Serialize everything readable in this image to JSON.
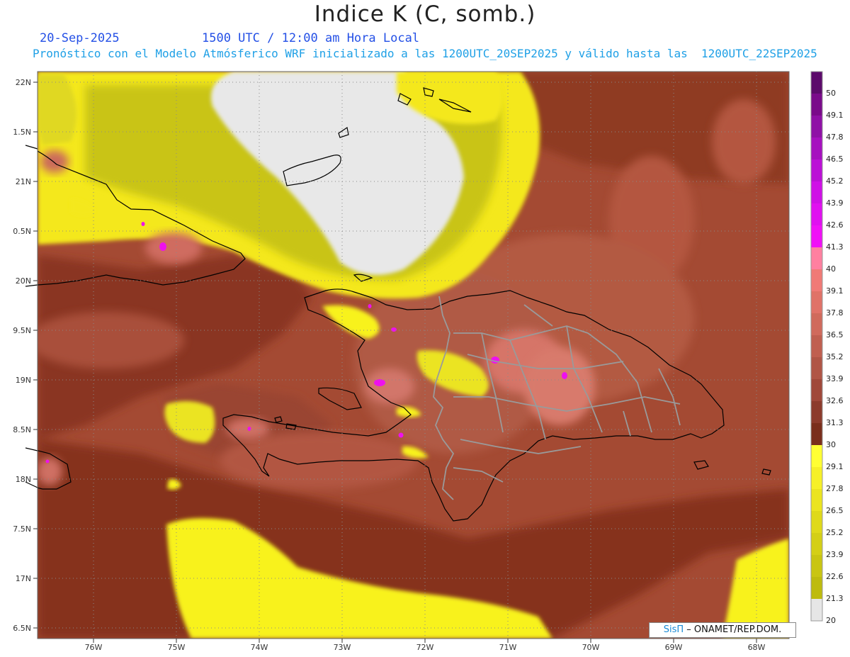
{
  "header": {
    "title": "Indice K (C, somb.)",
    "date": "20-Sep-2025",
    "time": "1500 UTC / 12:00 am Hora Local",
    "forecast": "Pronóstico con el Modelo Atmósferico WRF inicializado a las 1200UTC_20SEP2025 y válido hasta las  1200UTC_22SEP2025"
  },
  "map": {
    "lat_labels": [
      "22N",
      "1.5N",
      "21N",
      "0.5N",
      "20N",
      "9.5N",
      "19N",
      "8.5N",
      "18N",
      "7.5N",
      "17N",
      "6.5N"
    ],
    "lon_labels": [
      "76W",
      "75W",
      "74W",
      "73W",
      "72W",
      "71W",
      "70W",
      "69W",
      "68W"
    ],
    "background_color": "#a44a33",
    "grid": "dotted"
  },
  "colorbar": {
    "levels": [
      "50",
      "49.1",
      "47.8",
      "46.5",
      "45.2",
      "43.9",
      "42.6",
      "41.3",
      "40",
      "39.1",
      "37.8",
      "36.5",
      "35.2",
      "33.9",
      "32.6",
      "31.3",
      "30",
      "29.1",
      "27.8",
      "26.5",
      "25.2",
      "23.9",
      "22.6",
      "21.3",
      "20"
    ],
    "colors": [
      "#5c0a6b",
      "#7a0a8a",
      "#8f10a6",
      "#a610bf",
      "#bb10d6",
      "#cf10e6",
      "#e010f0",
      "#f010f7",
      "#ff80a0",
      "#f07a76",
      "#e07268",
      "#d06a5c",
      "#c05f50",
      "#b05546",
      "#a0483a",
      "#8c3b2c",
      "#7a2e1c",
      "#ffff33",
      "#f6f028",
      "#ebe420",
      "#dfd91a",
      "#d4cf16",
      "#c9c512",
      "#bebb0e",
      "#e6e6e6"
    ]
  },
  "credit": {
    "logo": "SisΠ",
    "text": " – ONAMET/REP.DOM."
  }
}
